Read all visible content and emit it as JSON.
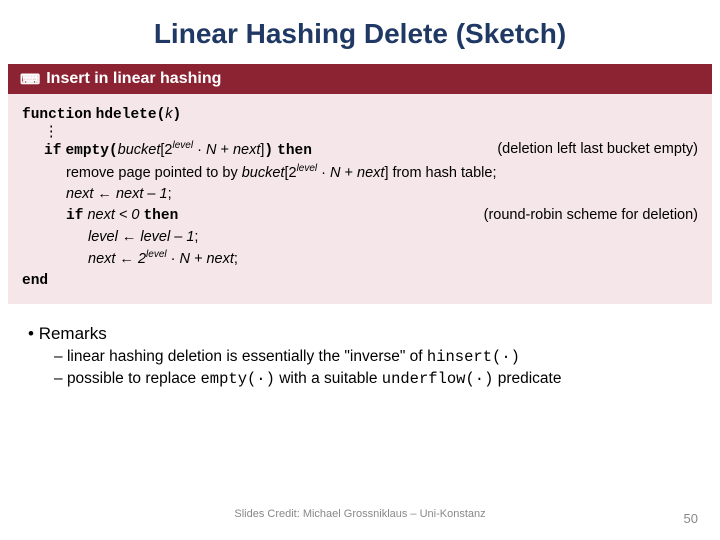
{
  "title": "Linear Hashing Delete (Sketch)",
  "banner": {
    "label": "Insert in linear hashing"
  },
  "code": {
    "fn_kw": "function",
    "fn_name": "hdelete",
    "fn_arg": "k",
    "if_kw": "if",
    "empty_fn": "empty",
    "bucket": "bucket",
    "level": "level",
    "N": "N",
    "next": "next",
    "then_kw": "then",
    "note_empty": "(deletion left last bucket empty)",
    "remove_line_a": "remove page pointed to by ",
    "remove_line_b": "[2",
    "remove_line_c": " · ",
    "remove_line_d": " + ",
    "remove_line_e": "] from hash table;",
    "next_assign": "next ← next – 1",
    "if2_cond": "next < 0",
    "note_round": "(round-robin scheme for deletion)",
    "level_assign": "level ← level – 1",
    "next_assign2_a": "next ← 2",
    "next_assign2_b": " · N + next",
    "end_kw": "end"
  },
  "remarks": {
    "heading": "Remarks",
    "item1_a": "linear hashing deletion is essentially the \"inverse\" of ",
    "item1_b": "hinsert(·)",
    "item2_a": "possible to replace ",
    "item2_b": "empty(·)",
    "item2_c": " with a suitable ",
    "item2_d": "underflow(·)",
    "item2_e": " predicate"
  },
  "footer": {
    "credit": "Slides Credit: Michael Grossniklaus – Uni-Konstanz",
    "page": "50"
  }
}
